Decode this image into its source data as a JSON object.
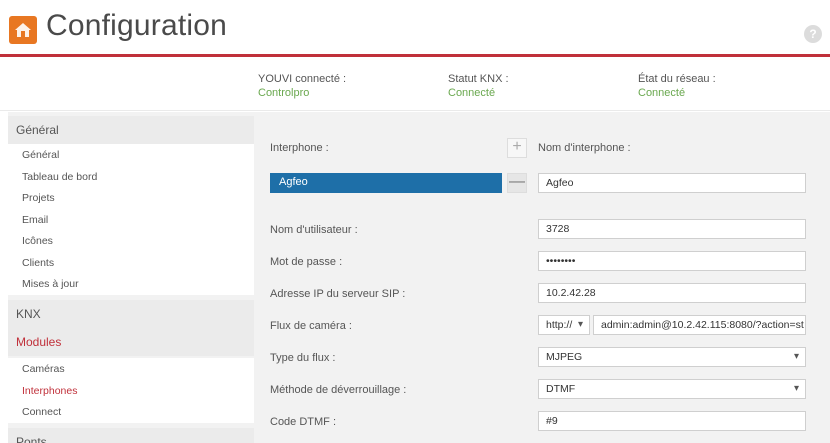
{
  "header": {
    "title": "Configuration",
    "help_label": "?",
    "accent_color": "#c0303a",
    "logo_color": "#e87722"
  },
  "status": {
    "youvi": {
      "label": "YOUVI connecté :",
      "value": "Controlpro"
    },
    "knx": {
      "label": "Statut KNX :",
      "value": "Connecté"
    },
    "network": {
      "label": "État du réseau :",
      "value": "Connecté"
    }
  },
  "sidebar": {
    "general": {
      "label": "Général",
      "items": [
        "Général",
        "Tableau de bord",
        "Projets",
        "Email",
        "Icônes",
        "Clients",
        "Mises à jour"
      ]
    },
    "knx": {
      "label": "KNX"
    },
    "modules": {
      "label": "Modules",
      "items": [
        "Caméras",
        "Interphones",
        "Connect"
      ],
      "active_item": "Interphones"
    },
    "next": {
      "label": "Ponts"
    }
  },
  "form": {
    "intercom_label": "Interphone :",
    "intercom_name_label": "Nom d'interphone :",
    "intercom_selected": "Agfeo",
    "intercom_name_value": "Agfeo",
    "add_label": "+",
    "remove_label": "—",
    "username_label": "Nom d'utilisateur :",
    "username_value": "3728",
    "password_label": "Mot de passe :",
    "password_value": "••••••••",
    "sip_label": "Adresse IP du serveur SIP :",
    "sip_value": "10.2.42.28",
    "camera_label": "Flux de caméra :",
    "camera_protocol": "http://",
    "camera_url": "admin:admin@10.2.42.115:8080/?action=st",
    "stream_type_label": "Type du flux :",
    "stream_type_value": "MJPEG",
    "unlock_label": "Méthode de déverrouillage :",
    "unlock_value": "DTMF",
    "dtmf_label": "Code DTMF :",
    "dtmf_value": "#9"
  }
}
